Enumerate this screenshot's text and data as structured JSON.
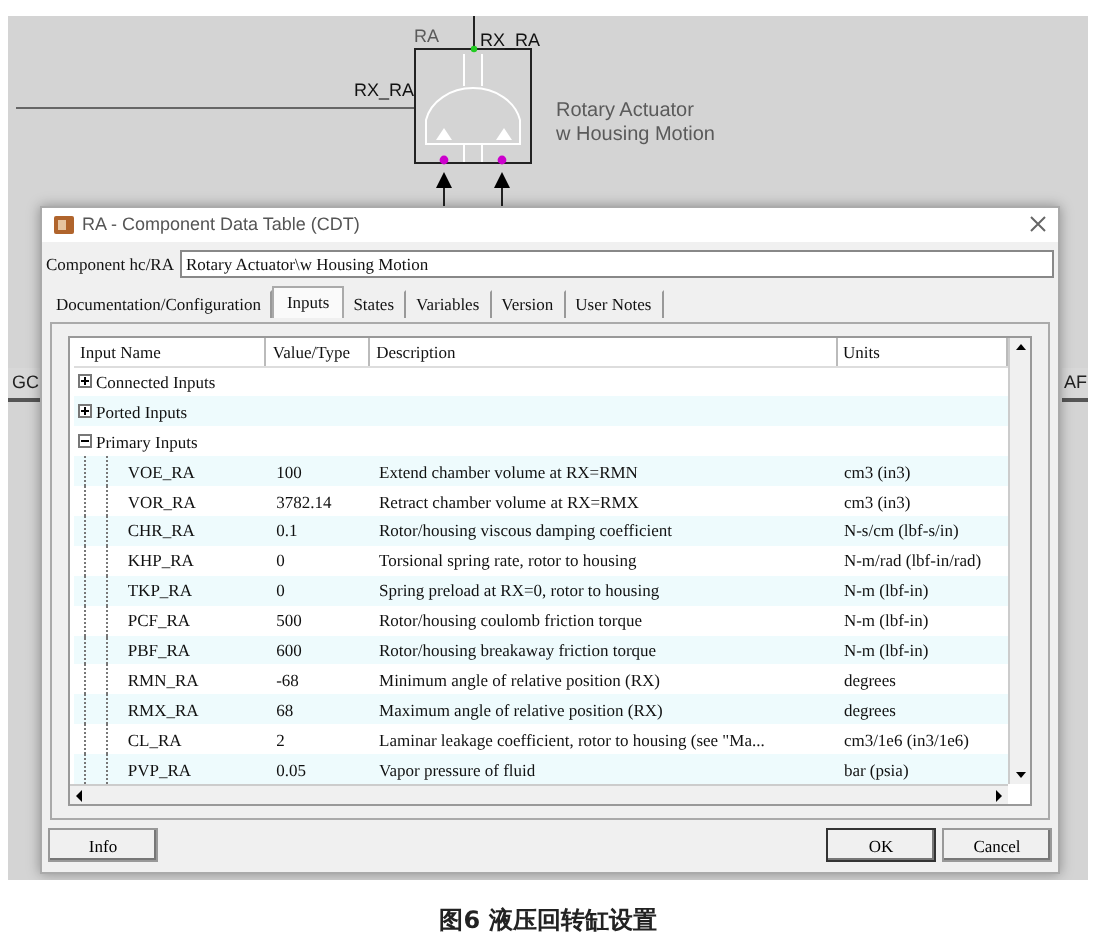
{
  "diagram": {
    "instance_label": "RA",
    "top_port": "RX_RA",
    "left_port": "RX_RA",
    "component_name": [
      "Rotary Actuator",
      "w Housing Motion"
    ],
    "side_blocks": [
      "GC",
      "AF"
    ]
  },
  "dialog": {
    "title": "RA - Component Data Table (CDT)",
    "component_label": "Component hc/RA",
    "component_value": "Rotary Actuator\\w Housing Motion",
    "tabs": [
      {
        "label": "Documentation/Configuration",
        "selected": false
      },
      {
        "label": "Inputs",
        "selected": true
      },
      {
        "label": "States",
        "selected": false
      },
      {
        "label": "Variables",
        "selected": false
      },
      {
        "label": "Version",
        "selected": false
      },
      {
        "label": "User Notes",
        "selected": false
      }
    ],
    "table": {
      "columns": [
        "Input Name",
        "Value/Type",
        "Description",
        "Units"
      ],
      "rows": [
        {
          "name": "Connected Inputs",
          "expanded": false
        },
        {
          "name": "Ported Inputs",
          "expanded": false
        },
        {
          "name": "Primary Inputs",
          "expanded": true,
          "children": [
            {
              "name": "VOE_RA",
              "value": "100",
              "description": "Extend chamber volume at RX=RMN",
              "units": "cm3 (in3)"
            },
            {
              "name": "VOR_RA",
              "value": "3782.14",
              "description": "Retract chamber volume at RX=RMX",
              "units": "cm3 (in3)"
            },
            {
              "name": "CHR_RA",
              "value": "0.1",
              "description": "Rotor/housing viscous damping coefficient",
              "units": "N-s/cm (lbf-s/in)"
            },
            {
              "name": "KHP_RA",
              "value": "0",
              "description": "Torsional spring rate, rotor to housing",
              "units": "N-m/rad (lbf-in/rad)"
            },
            {
              "name": "TKP_RA",
              "value": "0",
              "description": "Spring preload at RX=0, rotor to housing",
              "units": "N-m (lbf-in)"
            },
            {
              "name": "PCF_RA",
              "value": "500",
              "description": "Rotor/housing coulomb friction torque",
              "units": "N-m (lbf-in)"
            },
            {
              "name": "PBF_RA",
              "value": "600",
              "description": "Rotor/housing breakaway friction torque",
              "units": "N-m (lbf-in)"
            },
            {
              "name": "RMN_RA",
              "value": "-68",
              "description": "Minimum angle of relative position (RX)",
              "units": "degrees"
            },
            {
              "name": "RMX_RA",
              "value": "68",
              "description": "Maximum angle of relative position (RX)",
              "units": "degrees"
            },
            {
              "name": "CL_RA",
              "value": "2",
              "description": "Laminar leakage coefficient, rotor to housing (see \"Ma...",
              "units": "cm3/1e6 (in3/1e6)"
            },
            {
              "name": "PVP_RA",
              "value": "0.05",
              "description": "Vapor pressure of fluid",
              "units": "bar (psia)"
            }
          ]
        }
      ]
    },
    "buttons": [
      {
        "label": "Info",
        "kind": "default"
      },
      {
        "label": "OK",
        "kind": "primary"
      },
      {
        "label": "Cancel",
        "kind": "default"
      }
    ]
  },
  "caption": "图6 液压回转缸设置"
}
